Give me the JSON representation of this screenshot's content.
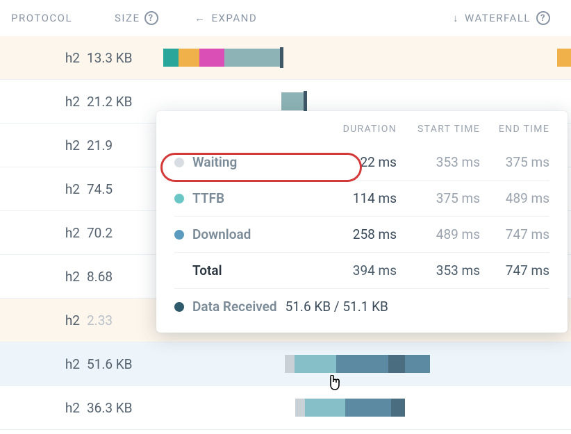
{
  "header": {
    "protocol": "PROTOCOL",
    "size": "SIZE",
    "expand": "EXPAND",
    "waterfall": "WATERFALL"
  },
  "rows": [
    {
      "protocol": "h2",
      "size": "13.3 KB"
    },
    {
      "protocol": "h2",
      "size": "21.2 KB"
    },
    {
      "protocol": "h2",
      "size": "21.9"
    },
    {
      "protocol": "h2",
      "size": "74.5"
    },
    {
      "protocol": "h2",
      "size": "70.2"
    },
    {
      "protocol": "h2",
      "size": "8.68"
    },
    {
      "protocol": "h2",
      "size": "2.33"
    },
    {
      "protocol": "h2",
      "size": "51.6 KB"
    },
    {
      "protocol": "h2",
      "size": "36.3 KB"
    }
  ],
  "tooltip": {
    "head": {
      "duration": "DURATION",
      "start": "START TIME",
      "end": "END TIME"
    },
    "rows": [
      {
        "label": "Waiting",
        "dotClass": "dot-waiting",
        "duration": "22 ms",
        "start": "353 ms",
        "end": "375 ms"
      },
      {
        "label": "TTFB",
        "dotClass": "dot-ttfb",
        "duration": "114 ms",
        "start": "375 ms",
        "end": "489 ms"
      },
      {
        "label": "Download",
        "dotClass": "dot-download",
        "duration": "258 ms",
        "start": "489 ms",
        "end": "747 ms"
      }
    ],
    "total": {
      "label": "Total",
      "duration": "394 ms",
      "start": "353 ms",
      "end": "747 ms"
    },
    "data": {
      "label": "Data Received",
      "value": "51.6 KB / 51.1 KB"
    }
  }
}
